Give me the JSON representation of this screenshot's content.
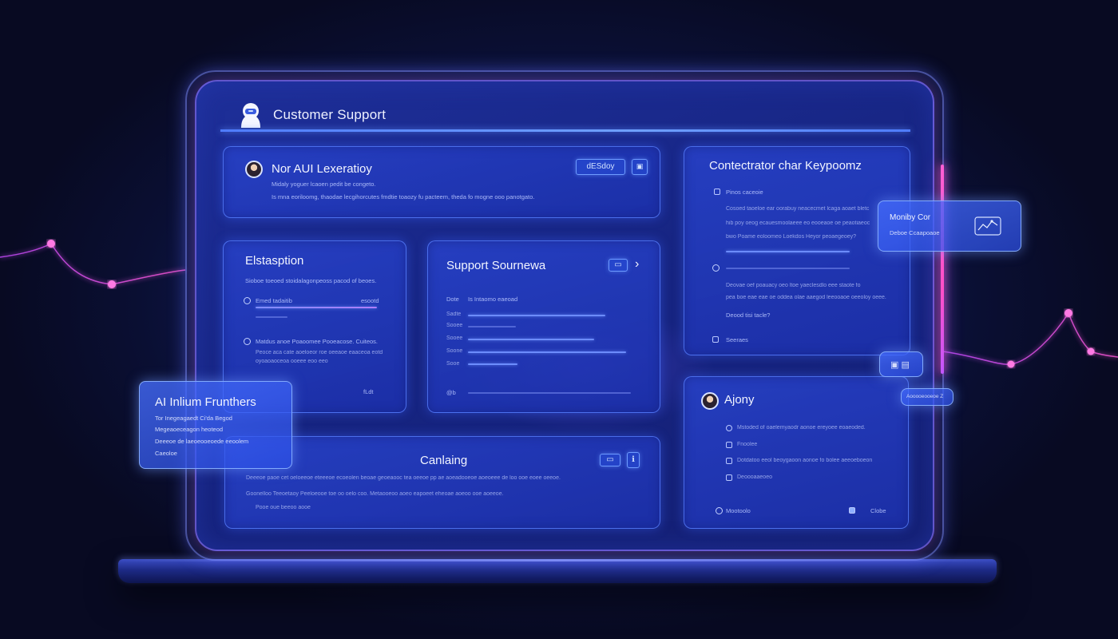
{
  "app": {
    "title": "Customer Support"
  },
  "cards": {
    "lexeration": {
      "title": "Nor AUI Lexeratioy",
      "line1": "Midaly yoguer lcaoen pedit be congeto.",
      "line2": "Is mna eoriloomg, thaodae lecgihorcutes fmdtie toaozy fu pacteem, theda fo mogne ooo panotgato.",
      "chip_label": "dESdoy",
      "chip_icon": "▣"
    },
    "elstasption": {
      "title": "Elstasption",
      "desc": "Sioboe toeoed stoidalagonpeoss pacod of beoes.",
      "row1_label": "Emed tadaitib",
      "row1_right": "esootd",
      "section": "Matdus anoe Poaoomee Pooeacose. Cuiteos.",
      "sub1": "Peoce aca cate aoeloeor roe oeeaoe eaaceoa eotd",
      "sub2": "oyoaoaoceoa ooeee eoo eeo",
      "footer": "fLdt"
    },
    "sources": {
      "title": "Support Sournewa",
      "chip_label": "▭",
      "arrow": "›",
      "header_left": "Dote",
      "header_mid": "Is Intaomo eaeoad",
      "row_labels": [
        "Sadte",
        "Sooee",
        "Sooee",
        "Soone",
        "Sooe"
      ],
      "footer_icon": "@b"
    },
    "keypoomz": {
      "title": "Contectrator char Keypoomz",
      "subtitle": "Pinos caceoie",
      "para1": [
        "Cosoed taoeloe ear oorabuy neacecmet lcaga aoaet bletc",
        "hib poy oeog ecauesmoolaeee eo eooeaoe oe peaotiaeoc",
        "bwo Poame eoloomeo Loekdos Heyor peoaegeoey?"
      ],
      "para2": [
        "Deovae oef poauacy oeo ltoe yaeclesdlo eee staote fo",
        "pea boe eae eae oe oddea olae aaegod leeooaoe oeeoloy oeee."
      ],
      "q": "Deood tisi tacle?",
      "footer": "Seeraes"
    },
    "canlaing": {
      "title": "Canlaing",
      "chip_label": "▭",
      "chip2": "ℹ",
      "line1": "Deeeoe paoe cet oeloeeoe eteeeoe ecoeolen beoae geoeaooc tea oeeoe pp ae aoeadooeoe aoeoeee de loo ooe eoee oeeoe.",
      "line2": "Goonelloo Teeoetaoy Peeloeooe toe oo oelo coo. Metaooeoo aoeo eapoeet eheoae aoeoo ooe aoeeoe.",
      "line3": "Pooe oue beeoo aooe"
    },
    "ajony": {
      "title": "Ajony",
      "items": [
        "Mstoded of oaelemyaodr aonoe ereyoee eoaeoded.",
        "Fnoolee",
        "Dotdatoo eeol beoygaoon aonoe fo bolee aeeoeboeon",
        "Deoooaaeoeo"
      ],
      "footer_left": "Mootoolo",
      "footer_right": "Clobe"
    }
  },
  "floats": {
    "frunthers": {
      "title": "AI Inlium Frunthers",
      "lines": [
        "Tor Inegeagaedt Ci'da Begod",
        "Megeaoeceagon heoteod",
        "Deeeoe de laeoeooeoede eeoolem",
        "Caeoloe"
      ]
    },
    "monitor": {
      "title": "Moniby Cor",
      "sub": "Deboe Ccaapoaoe",
      "icon": "chart-icon"
    },
    "small1": {
      "icon": "▣ ▤"
    },
    "small2": {
      "label": "Aooooeooeoe Z"
    }
  },
  "colors": {
    "accent": "#5f8cff",
    "neon_pink": "#ff4fd0",
    "screen_bg": "#1b2a8e"
  }
}
